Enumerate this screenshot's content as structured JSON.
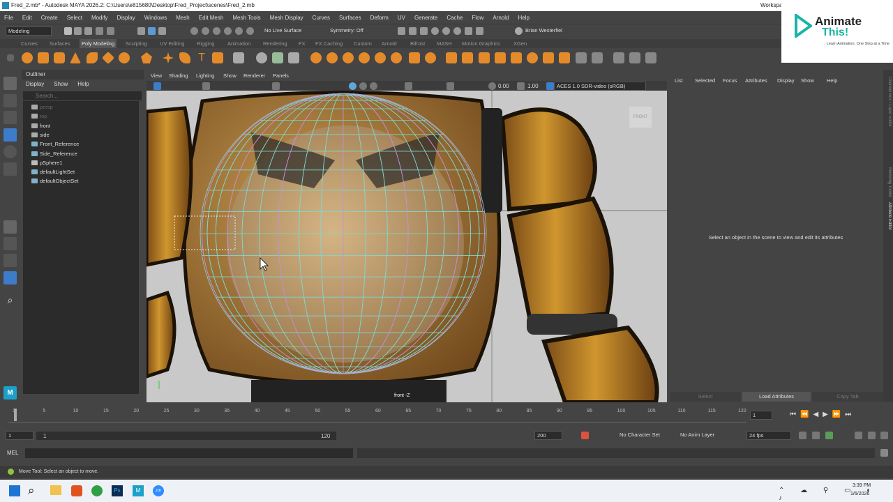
{
  "window": {
    "title": "Fred_2.mb* - Autodesk MAYA 2026.2: C:\\Users\\e815680\\Desktop\\Fred_Project\\scenes\\Fred_2.mb",
    "workspace": "Workspa"
  },
  "menubar": [
    "File",
    "Edit",
    "Create",
    "Select",
    "Modify",
    "Display",
    "Windows",
    "Mesh",
    "Edit Mesh",
    "Mesh Tools",
    "Mesh Display",
    "Curves",
    "Surfaces",
    "Deform",
    "UV",
    "Generate",
    "Cache",
    "Flow",
    "Arnold",
    "Help"
  ],
  "statusline": {
    "mode": "Modeling",
    "live_surface": "No Live Surface",
    "symmetry": "Symmetry: Off",
    "user": "Brian Westerfiel"
  },
  "shelf_tabs": [
    "Curves",
    "Surfaces",
    "Poly Modeling",
    "Sculpting",
    "UV Editing",
    "Rigging",
    "Animation",
    "Rendering",
    "FX",
    "FX Caching",
    "Custom",
    "Arnold",
    "Bifrost",
    "MASH",
    "Motion Graphics",
    "XGen"
  ],
  "shelf_active": "Poly Modeling",
  "outliner": {
    "title": "Outliner",
    "menu": [
      "Display",
      "Show",
      "Help"
    ],
    "search_placeholder": "Search...",
    "items": [
      {
        "label": "persp",
        "dim": true
      },
      {
        "label": "top",
        "dim": true
      },
      {
        "label": "front",
        "dim": false
      },
      {
        "label": "side",
        "dim": false
      },
      {
        "label": "Front_Reference",
        "dim": false
      },
      {
        "label": "Side_Reference",
        "dim": false
      },
      {
        "label": "pSphere1",
        "dim": false
      },
      {
        "label": "defaultLightSet",
        "dim": false
      },
      {
        "label": "defaultObjectSet",
        "dim": false
      }
    ]
  },
  "viewport": {
    "menu": [
      "View",
      "Shading",
      "Lighting",
      "Show",
      "Renderer",
      "Panels"
    ],
    "exposure": "0.00",
    "gamma": "1.00",
    "color_space": "ACES 1.0 SDR-video (sRGB)",
    "cube_label": "FRONT",
    "camera_label": "front -Z"
  },
  "attribute_editor": {
    "menu": [
      "List",
      "Selected",
      "Focus",
      "Attributes",
      "Display",
      "Show",
      "Help"
    ],
    "message": "Select an object in the scene to view and edit its attributes",
    "buttons": [
      "Select",
      "Load Attributes",
      "Copy Tab"
    ],
    "side_tabs": [
      "Channel Box / Layer Editor",
      "Modeling Toolkit",
      "Attribute Editor"
    ]
  },
  "timeline": {
    "ticks": [
      "1",
      "5",
      "10",
      "15",
      "20",
      "25",
      "30",
      "35",
      "40",
      "45",
      "50",
      "55",
      "60",
      "65",
      "70",
      "75",
      "80",
      "85",
      "90",
      "95",
      "100",
      "105",
      "110",
      "115",
      "120"
    ],
    "current_frame": "1"
  },
  "range": {
    "start": "1",
    "inner_start": "1",
    "inner_end": "120",
    "end": "200",
    "character_set": "No Character Set",
    "anim_layer": "No Anim Layer",
    "fps": "24 fps"
  },
  "mel": {
    "label": "MEL"
  },
  "help_line": "Move Tool: Select an object to move.",
  "taskbar": {
    "time": "3:39 PM",
    "date": "1/6/2026"
  },
  "brand": {
    "name_line1": "Animate",
    "name_line2": "This!",
    "tagline": "Learn Animation, One Step at a Time",
    "color": "#19b5a5"
  }
}
